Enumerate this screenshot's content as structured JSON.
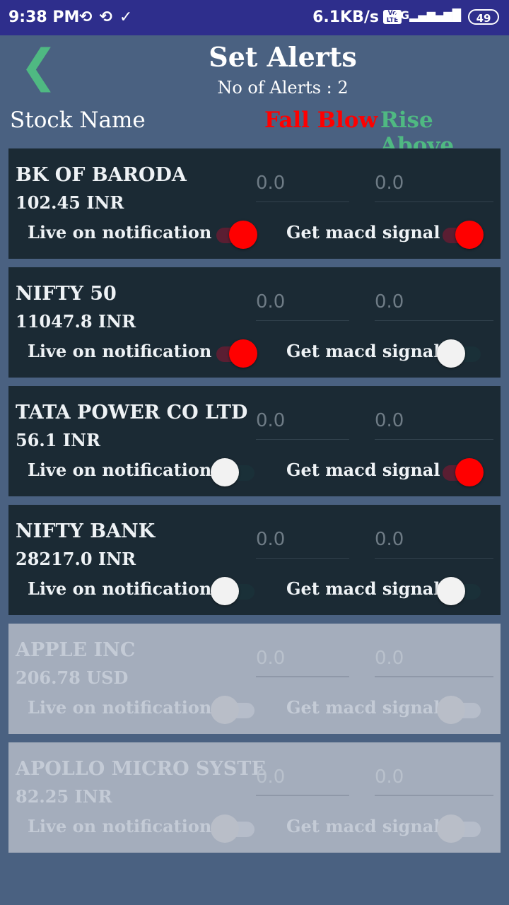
{
  "status_bar": {
    "time": "9:38 PM",
    "speed": "6.1KB/s",
    "network_label": "4G",
    "volte": "Vo LTE",
    "battery": "49"
  },
  "header": {
    "back_icon": "chevron-left-icon",
    "title": "Set Alerts",
    "subtitle": "No of Alerts : 2"
  },
  "columns": {
    "stock_name": "Stock Name",
    "fall_below": "Fall Blow",
    "rise_above": "Rise Above"
  },
  "colors": {
    "accent_green": "#4fb982",
    "alert_red": "#ff0000",
    "background": "#4a6181",
    "card": "#1b2a34"
  },
  "stocks": [
    {
      "name": "BK OF BARODA",
      "price": "102.45 INR",
      "fall_placeholder": "0.0",
      "rise_placeholder": "0.0",
      "live_label": "Live on notification",
      "macd_label": "Get macd signal",
      "live_on": true,
      "macd_on": true,
      "enabled": true
    },
    {
      "name": "NIFTY 50",
      "price": "11047.8 INR",
      "fall_placeholder": "0.0",
      "rise_placeholder": "0.0",
      "live_label": "Live on notification",
      "macd_label": "Get macd signal",
      "live_on": true,
      "macd_on": false,
      "enabled": true
    },
    {
      "name": "TATA POWER CO LTD",
      "price": "56.1 INR",
      "fall_placeholder": "0.0",
      "rise_placeholder": "0.0",
      "live_label": "Live on notification",
      "macd_label": "Get macd signal",
      "live_on": false,
      "macd_on": true,
      "enabled": true
    },
    {
      "name": "NIFTY BANK",
      "price": "28217.0 INR",
      "fall_placeholder": "0.0",
      "rise_placeholder": "0.0",
      "live_label": "Live on notification",
      "macd_label": "Get macd signal",
      "live_on": false,
      "macd_on": false,
      "enabled": true
    },
    {
      "name": "APPLE INC",
      "price": "206.78 USD",
      "fall_placeholder": "0.0",
      "rise_placeholder": "0.0",
      "live_label": "Live on notification",
      "macd_label": "Get macd signal",
      "live_on": false,
      "macd_on": false,
      "enabled": false
    },
    {
      "name": "APOLLO MICRO SYSTE",
      "price": "82.25 INR",
      "fall_placeholder": "0.0",
      "rise_placeholder": "0.0",
      "live_label": "Live on notification",
      "macd_label": "Get macd signal",
      "live_on": false,
      "macd_on": false,
      "enabled": false
    }
  ]
}
